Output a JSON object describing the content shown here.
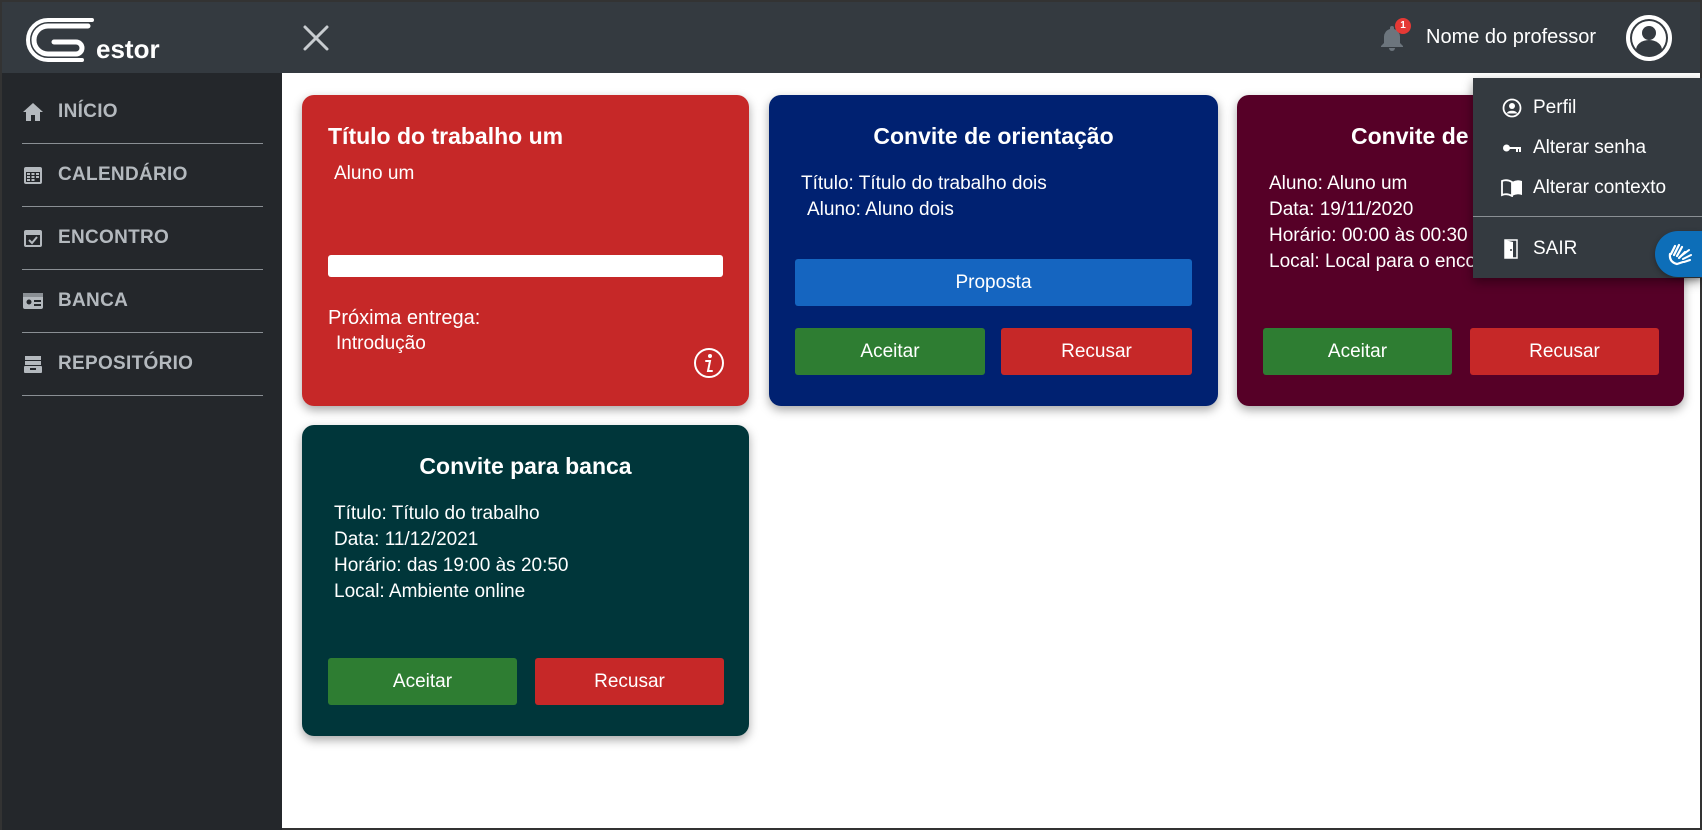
{
  "header": {
    "logo_text": "estor",
    "notification_count": "1",
    "user_name": "Nome do professor"
  },
  "sidebar": {
    "items": [
      {
        "label": "INÍCIO",
        "icon": "home-icon"
      },
      {
        "label": "CALENDÁRIO",
        "icon": "calendar-icon"
      },
      {
        "label": "ENCONTRO",
        "icon": "calendar-check-icon"
      },
      {
        "label": "BANCA",
        "icon": "id-card-icon"
      },
      {
        "label": "REPOSITÓRIO",
        "icon": "archive-icon"
      }
    ]
  },
  "cards": {
    "work": {
      "title": "Título do trabalho um",
      "student": "Aluno um",
      "progress_percent": 100,
      "next_delivery_label": "Próxima entrega:",
      "next_delivery_value": "Introdução"
    },
    "orientation": {
      "title": "Convite de orientação",
      "line1": "Título: Título do trabalho dois",
      "line2": "Aluno: Aluno dois",
      "proposal_label": "Proposta",
      "accept_label": "Aceitar",
      "reject_label": "Recusar"
    },
    "meeting": {
      "title": "Convite de",
      "line1": "Aluno: Aluno um",
      "line2": "Data: 19/11/2020",
      "line3": "Horário: 00:00 às 00:30",
      "line4": "Local: Local para o enco",
      "accept_label": "Aceitar",
      "reject_label": "Recusar"
    },
    "board": {
      "title": "Convite para banca",
      "line1": "Título: Título do trabalho",
      "line2": "Data: 11/12/2021",
      "line3": "Horário: das 19:00 às 20:50",
      "line4": "Local: Ambiente online",
      "accept_label": "Aceitar",
      "reject_label": "Recusar"
    }
  },
  "dropdown": {
    "items": [
      {
        "label": "Perfil",
        "icon": "user-circle-icon"
      },
      {
        "label": "Alterar senha",
        "icon": "key-icon"
      },
      {
        "label": "Alterar contexto",
        "icon": "book-icon"
      },
      {
        "label": "SAIR",
        "icon": "door-icon"
      }
    ]
  },
  "colors": {
    "header": "#343a40",
    "sidebar": "#24272b",
    "card_work": "#c62828",
    "card_orientation": "#002171",
    "card_meeting": "#560027",
    "card_board": "#00363a",
    "accept": "#2e7d32",
    "reject": "#c62828",
    "proposal": "#1565c0"
  }
}
